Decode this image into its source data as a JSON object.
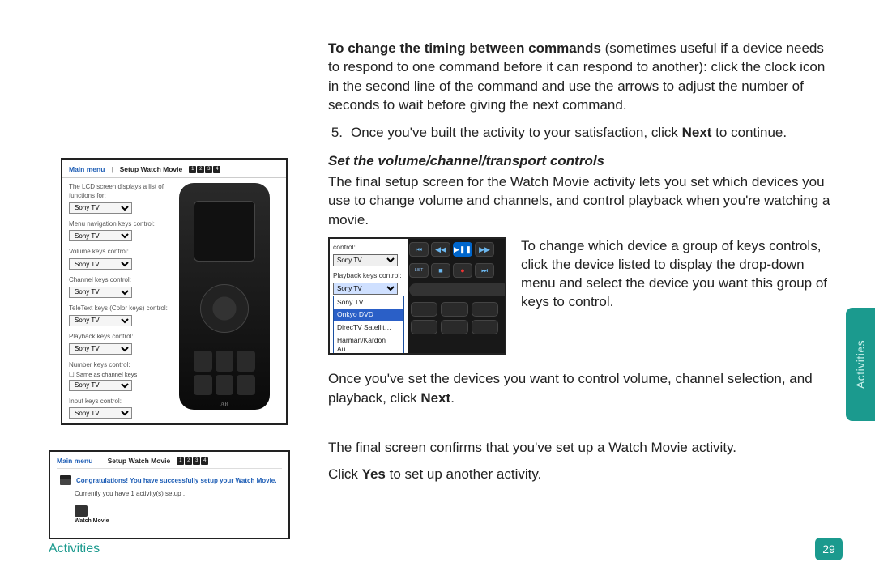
{
  "sideTab": "Activities",
  "footer": {
    "section": "Activities",
    "page": "29"
  },
  "top": {
    "timing_lead_bold": "To change the timing between commands",
    "timing_rest": " (sometimes useful if a device needs to respond to one command before it can respond to another): click the clock icon in the second line of the command and use the arrows to adjust the number of seconds to wait before giving the next command.",
    "step5_num": "5.",
    "step5_a": "Once you've built the activity to your satisfaction, click ",
    "step5_bold": "Next",
    "step5_b": " to continue."
  },
  "section": {
    "heading": "Set the volume/channel/transport controls",
    "p1": "The final setup screen for the Watch Movie activity lets you set which devices you use to change volume and channels, and control playback when you're watching a movie.",
    "p2": "To change which device a group of keys controls, click the device listed to display the drop-down menu and select the device you want this group of keys to control.",
    "p3a": "Once you've set the devices you want to control volume, channel selection, and playback, click ",
    "p3bold": "Next",
    "p3b": ".",
    "p4": "The final screen confirms that you've set up a Watch Movie activity.",
    "p5a": "Click ",
    "p5bold": "Yes",
    "p5b": " to set up another activity."
  },
  "shot1": {
    "mainmenu": "Main menu",
    "bc": "Setup Watch Movie",
    "intro": "The LCD screen displays a list of functions for:",
    "groups": {
      "lcd_sel": "Sony TV",
      "menu_lbl": "Menu navigation keys control:",
      "menu_sel": "Sony TV",
      "vol_lbl": "Volume keys control:",
      "vol_sel": "Sony TV",
      "chan_lbl": "Channel keys control:",
      "chan_sel": "Sony TV",
      "tele_lbl": "TeleText keys (Color keys) control:",
      "tele_sel": "Sony TV",
      "play_lbl": "Playback keys control:",
      "play_sel": "Sony TV",
      "num_lbl": "Number keys control:",
      "num_chk": "Same as channel keys",
      "num_sel": "Sony TV",
      "inp_lbl": "Input keys control:",
      "inp_sel": "Sony TV"
    }
  },
  "shot2": {
    "top_lbl": "control:",
    "top_sel": "Sony TV",
    "play_lbl": "Playback keys control:",
    "play_sel": "Sony TV",
    "opts": [
      "Sony TV",
      "Onkyo DVD",
      "DirecTV Satellit…",
      "Harman/Kardon Au…"
    ],
    "selected_index": 1
  },
  "shot3": {
    "mainmenu": "Main menu",
    "bc": "Setup Watch Movie",
    "congrats": "Congratulations! You have successfully setup your Watch Movie.",
    "count": "Currently you have 1 activity(s) setup .",
    "act_label": "Watch Movie"
  }
}
